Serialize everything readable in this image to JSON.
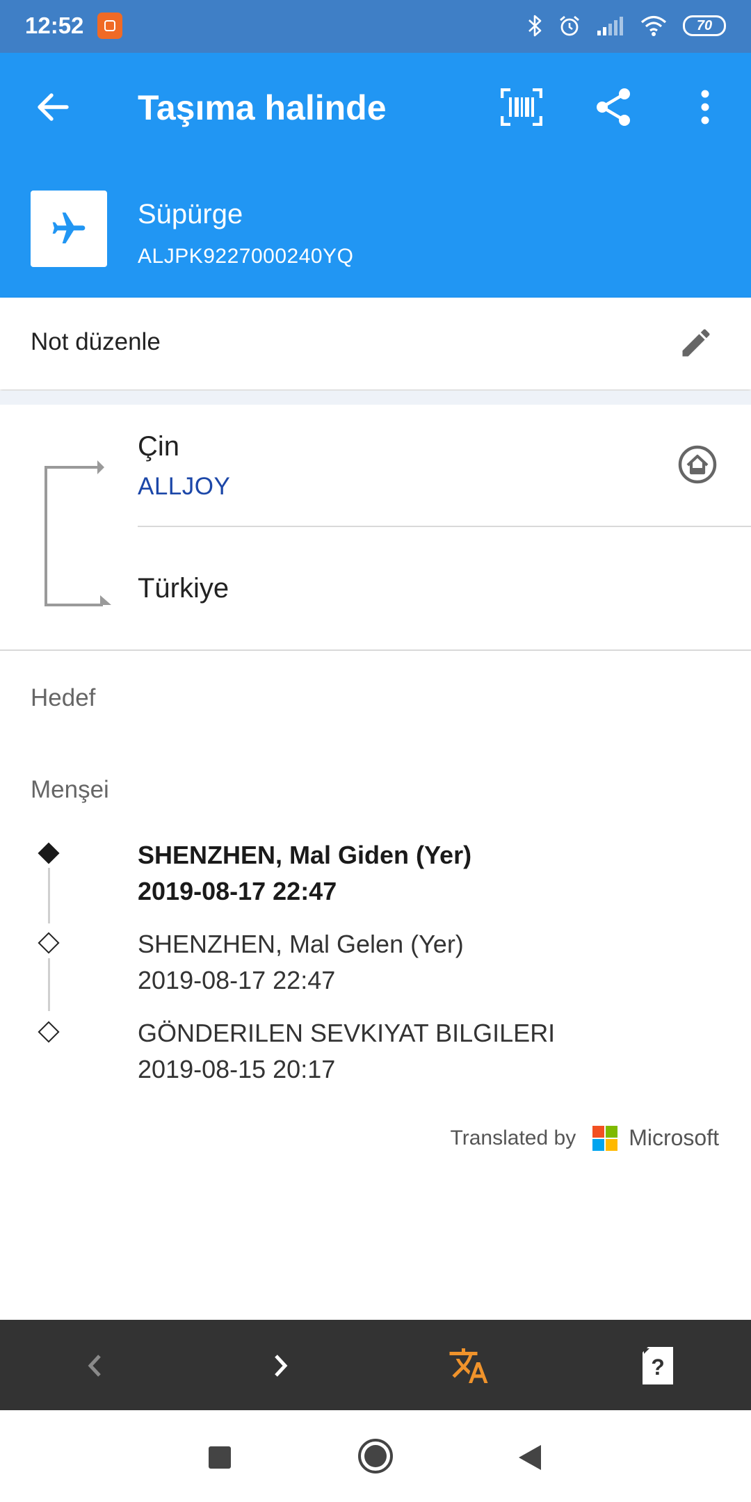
{
  "status_bar": {
    "time": "12:52",
    "battery": "70",
    "icons": [
      "bluetooth-icon",
      "alarm-icon",
      "signal-icon",
      "wifi-icon",
      "battery-icon"
    ]
  },
  "app_bar": {
    "title": "Taşıma halinde",
    "actions": [
      "back-arrow-icon",
      "barcode-icon",
      "share-icon",
      "more-vert-icon"
    ]
  },
  "package": {
    "name": "Süpürge",
    "tracking_code": "ALJPK9227000240YQ",
    "icon": "airplane-icon"
  },
  "note": {
    "label": "Not düzenle",
    "icon": "pencil-icon"
  },
  "route": {
    "origin_country": "Çin",
    "carrier": "ALLJOY",
    "destination_country": "Türkiye",
    "carrier_icon": "home-circle-icon"
  },
  "sections": {
    "destination_label": "Hedef",
    "origin_label": "Menşei"
  },
  "events": [
    {
      "description": "SHENZHEN, Mal Giden (Yer)",
      "datetime": "2019-08-17 22:47",
      "latest": true
    },
    {
      "description": "SHENZHEN, Mal Gelen (Yer)",
      "datetime": "2019-08-17 22:47",
      "latest": false
    },
    {
      "description": "GÖNDERILEN SEVKIYAT BILGILERI",
      "datetime": "2019-08-15 20:17",
      "latest": false
    }
  ],
  "translation": {
    "label": "Translated by",
    "provider": "Microsoft"
  },
  "bottom_toolbar": [
    "chevron-left-icon",
    "chevron-right-icon",
    "translate-icon",
    "help-card-icon"
  ],
  "system_nav": [
    "recents-square-icon",
    "home-circle-icon",
    "back-triangle-icon"
  ],
  "colors": {
    "app_bar": "#2196f3",
    "status_bar": "#3f7fc6",
    "carrier_text": "#1c47a8",
    "translate_accent": "#f0932b",
    "toolbar": "#333333"
  }
}
